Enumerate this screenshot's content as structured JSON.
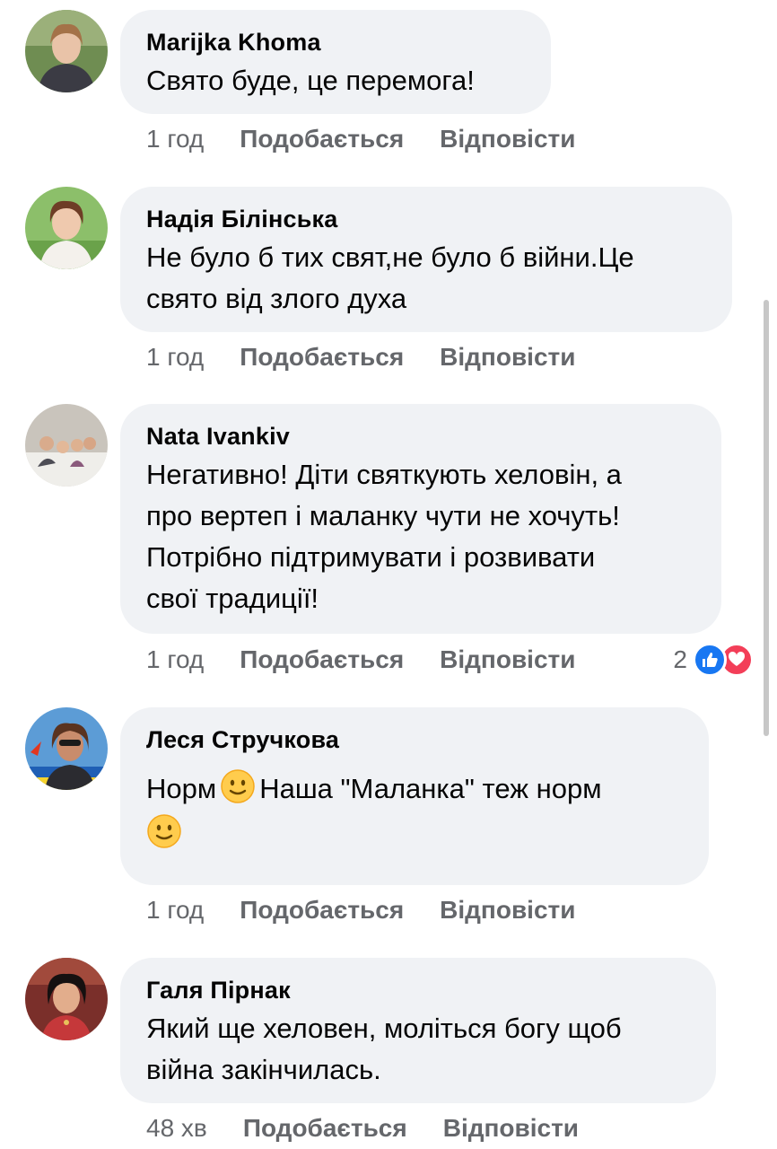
{
  "comments": [
    {
      "author": "Marijka Khoma",
      "text": "Свято буде, це перемога!",
      "time": "1 год",
      "like_label": "Подобається",
      "reply_label": "Відповісти"
    },
    {
      "author": "Надія Білінська",
      "text": "Не було б тих свят,не було б війни.Це\nсвято від злого духа",
      "time": "1 год",
      "like_label": "Подобається",
      "reply_label": "Відповісти"
    },
    {
      "author": "Nata Ivankiv",
      "text": "Негативно! Діти святкують хеловін, а\nпро вертеп і маланку чути не хочуть!\nПотрібно підтримувати і розвивати\nсвої традиції!",
      "time": "1 год",
      "like_label": "Подобається",
      "reply_label": "Відповісти",
      "reaction_count": "2",
      "reaction_icons": [
        "like-icon",
        "love-icon"
      ]
    },
    {
      "author": "Леся Стручкова",
      "text_part1": "Норм",
      "text_part2": "Наша \"Маланка\" теж норм",
      "emoji": "slightly-smiling-face",
      "time": "1 год",
      "like_label": "Подобається",
      "reply_label": "Відповісти"
    },
    {
      "author": "Галя Пірнак",
      "text": "Який ще хеловен, моліться богу щоб\nвійна закінчилась.",
      "time": "48 хв",
      "like_label": "Подобається",
      "reply_label": "Відповісти"
    }
  ],
  "colors": {
    "bubble": "#f0f2f5",
    "meta_text": "#65676b",
    "like_blue": "#1877f2",
    "love_red": "#f33e58"
  }
}
